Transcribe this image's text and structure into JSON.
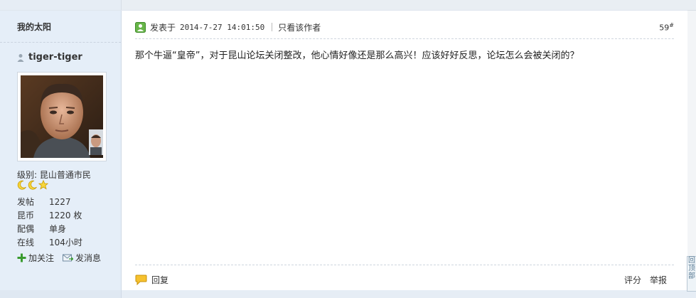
{
  "sidebar": {
    "section_title": "我的太阳",
    "username": "tiger-tiger",
    "level_label": "级别: 昆山普通市民",
    "stats": [
      {
        "key": "发帖",
        "value": "1227"
      },
      {
        "key": "昆币",
        "value": "1220 枚"
      },
      {
        "key": "配偶",
        "value": "单身"
      },
      {
        "key": "在线",
        "value": "104小时"
      }
    ],
    "follow_label": "加关注",
    "message_label": "发消息"
  },
  "post": {
    "posted_label": "发表于",
    "timestamp": "2014-7-27 14:01:50",
    "only_author_label": "只看该作者",
    "floor": "59",
    "floor_suffix": "#",
    "content": "那个牛逼“皇帝”，对于昆山论坛关闭整改，他心情好像还是那么高兴！应该好好反思，论坛怎么会被关闭的？",
    "reply_label": "回复",
    "rate_label": "评分",
    "report_label": "举报"
  },
  "scroll_widget": {
    "label": "回顶部"
  },
  "colors": {
    "sidebar_bg": "#e5eef8",
    "accent_green": "#3a9b2f",
    "star_yellow": "#f2c200"
  }
}
